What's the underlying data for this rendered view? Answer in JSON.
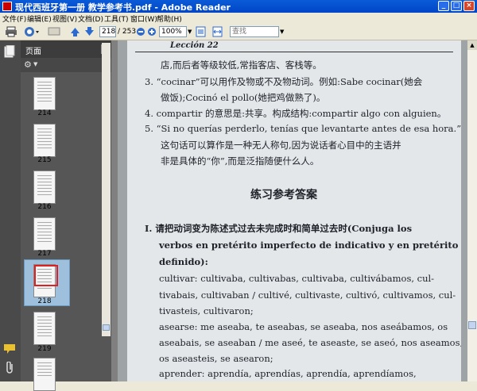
{
  "window": {
    "title": "现代西班牙第一册 教学参考书.pdf - Adobe Reader"
  },
  "menu": [
    {
      "label": "文件(F)"
    },
    {
      "label": "编辑(E)"
    },
    {
      "label": "视图(V)"
    },
    {
      "label": "文档(D)"
    },
    {
      "label": "工具(T)"
    },
    {
      "label": "窗口(W)"
    },
    {
      "label": "帮助(H)"
    }
  ],
  "toolbar": {
    "page_current": "218",
    "page_total": "/ 253",
    "zoom": "100%",
    "search_placeholder": "查找"
  },
  "pane": {
    "title": "页面"
  },
  "thumbnails": [
    {
      "label": "214",
      "selected": false
    },
    {
      "label": "215",
      "selected": false
    },
    {
      "label": "216",
      "selected": false
    },
    {
      "label": "217",
      "selected": false
    },
    {
      "label": "218",
      "selected": true
    },
    {
      "label": "219",
      "selected": false
    }
  ],
  "document": {
    "lines": [
      {
        "text": "Lección 22"
      },
      {
        "text": "店,而后者等级较低,常指客店、客栈等。"
      },
      {
        "text": "3. “cocinar”可以用作及物或不及物动词。例如:Sabe cocinar(她会"
      },
      {
        "text": "做饭);Cocinó el pollo(她把鸡做熟了)。"
      },
      {
        "text": "4. compartir 的意思是:共享。构成结构:compartir algo con alguien。"
      },
      {
        "text": "5. “Si no querías perderlo, tenías que levantarte antes de esa hora.”"
      },
      {
        "text": "这句话可以算作是一种无人称句,因为说话者心目中的主语并"
      },
      {
        "text": "非是具体的“你”,而是泛指随便什么人。"
      },
      {
        "text": "练习参考答案"
      },
      {
        "text": "I. 请把动词变为陈述式过去未完成时和简单过去时(Conjuga los"
      },
      {
        "text": "verbos en pretérito imperfecto de indicativo y en pretérito in-"
      },
      {
        "text": "definido):"
      },
      {
        "text": "cultivar: cultivaba, cultivabas, cultivaba, cultivábamos, cul-"
      },
      {
        "text": "tivabais, cultivaban / cultivé, cultivaste, cultivó, cultivamos, cul-"
      },
      {
        "text": "tivasteis, cultivaron;"
      },
      {
        "text": "asearse: me aseaba, te aseabas, se aseaba, nos aseábamos, os"
      },
      {
        "text": "aseabais, se aseaban / me aseé, te aseaste, se aseó, nos aseamos,"
      },
      {
        "text": "os aseasteis, se asearon;"
      },
      {
        "text": "aprender: aprendía, aprendías, aprendía, aprendíamos,"
      }
    ]
  }
}
